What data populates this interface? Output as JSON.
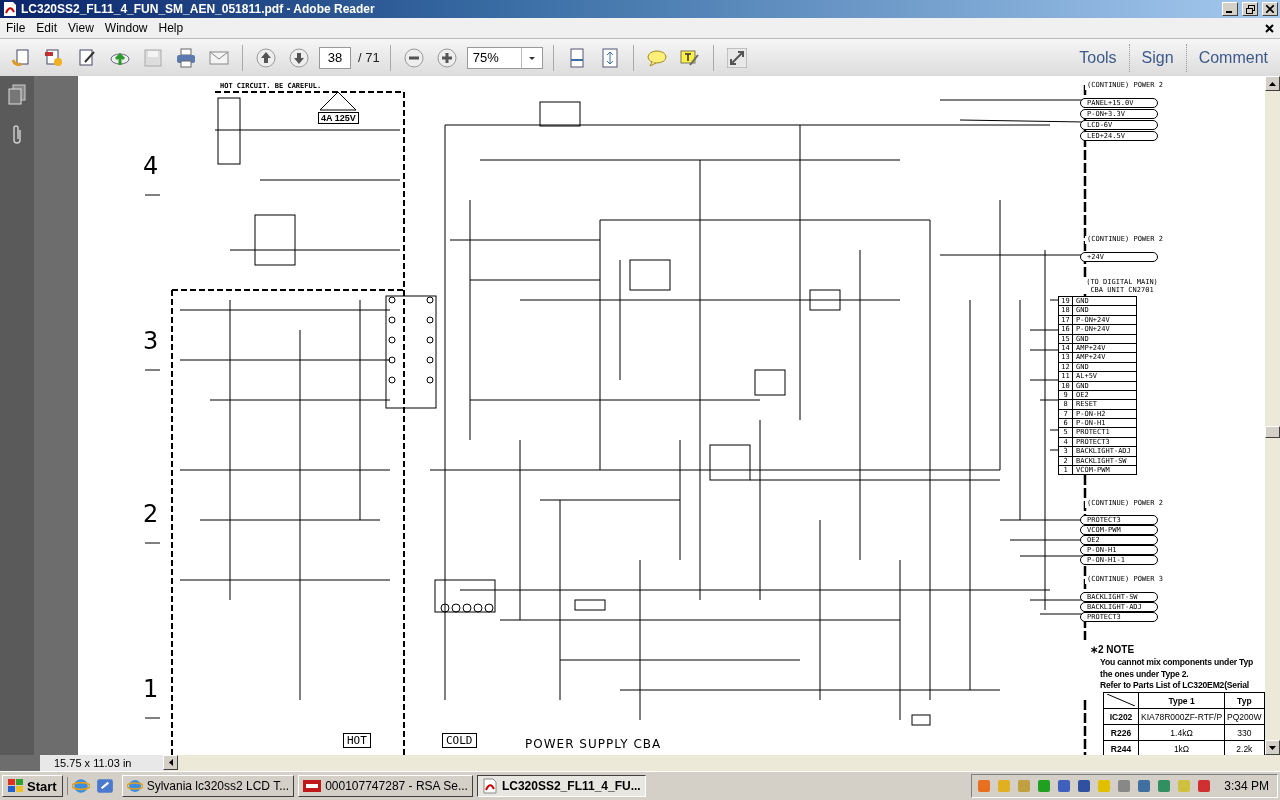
{
  "window": {
    "title": "LC320SS2_FL11_4_FUN_SM_AEN_051811.pdf - Adobe Reader"
  },
  "menu": [
    "File",
    "Edit",
    "View",
    "Window",
    "Help"
  ],
  "toolbar": {
    "page_number": "38",
    "page_total": "/ 71",
    "zoom": "75%",
    "panels": [
      "Tools",
      "Sign",
      "Comment"
    ]
  },
  "document": {
    "page_size": "15.75 x 11.03 in",
    "schematic": {
      "row_markers": [
        "4",
        "3",
        "2",
        "1"
      ],
      "warning": "HOT CIRCUIT. BE CAREFUL.",
      "fuse_label": "4A 125V",
      "area_labels": [
        "HOT",
        "COLD"
      ],
      "title": "POWER SUPPLY CBA",
      "connector_groups": [
        {
          "heading": "(CONTINUE) POWER 2",
          "labels": [
            "PANEL+15.0V",
            "P-ON+3.3V",
            "LCD-6V",
            "LED+24.5V"
          ]
        },
        {
          "heading": "(CONTINUE) POWER 2",
          "labels": [
            "+24V"
          ]
        },
        {
          "heading": "(CONTINUE) POWER 2",
          "labels": [
            "PROTECT3",
            "VCOM-PWM",
            "OE2",
            "P-ON-H1",
            "P-ON-H1-1"
          ]
        },
        {
          "heading": "(CONTINUE) POWER 3",
          "labels": [
            "BACKLIGHT-SW",
            "BACKLIGHT-ADJ",
            "PROTECT3"
          ]
        }
      ],
      "connector": {
        "heading": "(TO DIGITAL MAIN) CBA UNIT CN2701",
        "pins": [
          {
            "number": "19",
            "name": "GND"
          },
          {
            "number": "18",
            "name": "GND"
          },
          {
            "number": "17",
            "name": "P-ON+24V"
          },
          {
            "number": "16",
            "name": "P-ON+24V"
          },
          {
            "number": "15",
            "name": "GND"
          },
          {
            "number": "14",
            "name": "AMP+24V"
          },
          {
            "number": "13",
            "name": "AMP+24V"
          },
          {
            "number": "12",
            "name": "GND"
          },
          {
            "number": "11",
            "name": "AL+5V"
          },
          {
            "number": "10",
            "name": "GND"
          },
          {
            "number": "9",
            "name": "OE2"
          },
          {
            "number": "8",
            "name": "RESET"
          },
          {
            "number": "7",
            "name": "P-ON-H2"
          },
          {
            "number": "6",
            "name": "P-ON-H1"
          },
          {
            "number": "5",
            "name": "PROTECT1"
          },
          {
            "number": "4",
            "name": "PROTECT3"
          },
          {
            "number": "3",
            "name": "BACKLIGHT-ADJ"
          },
          {
            "number": "2",
            "name": "BACKLIGHT-SW"
          },
          {
            "number": "1",
            "name": "VCOM-PWM"
          }
        ]
      }
    },
    "note": {
      "title": "∗2 NOTE",
      "lines": [
        "You cannot mix components under Typ",
        "the ones under Type 2.",
        "Refer to Parts List of LC320EM2(Serial"
      ],
      "table": {
        "columns": [
          "Type 1",
          "Typ"
        ],
        "rows": [
          {
            "part": "IC202",
            "type_1": "KIA78R000ZF-RTF/P",
            "type_2": "PQ200W"
          },
          {
            "part": "R226",
            "type_1": "1.4kΩ",
            "type_2": "330"
          },
          {
            "part": "R244",
            "type_1": "1kΩ",
            "type_2": "2.2k"
          }
        ]
      }
    }
  },
  "taskbar": {
    "start": "Start",
    "tasks": [
      {
        "label": "Sylvania lc320ss2 LCD T...",
        "selected": false
      },
      {
        "label": "000107747287 - RSA Se...",
        "selected": false
      },
      {
        "label": "LC320SS2_FL11_4_FU...",
        "selected": true
      }
    ],
    "clock": "3:34 PM"
  }
}
